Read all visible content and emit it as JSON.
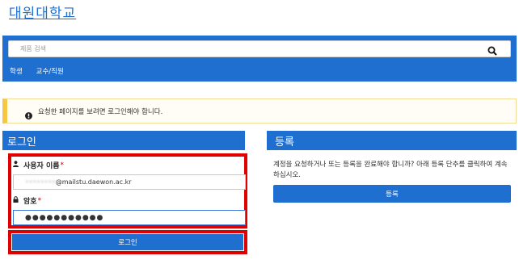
{
  "header": {
    "site_title": "대원대학교"
  },
  "search": {
    "placeholder": "제품 검색",
    "icon": "search-icon"
  },
  "nav": {
    "items": [
      {
        "label": "학생"
      },
      {
        "label": "교수/직원"
      }
    ]
  },
  "alert": {
    "text": "요청한 페이지를 보려면 로그인해야 합니다.",
    "icon": "exclamation-circle-icon",
    "accent_color": "#f6c744"
  },
  "login": {
    "title": "로그인",
    "username_label": "사용자 이름",
    "required_mark": "*",
    "username_prefix": "••••••••",
    "username_value": "@mailstu.daewon.ac.kr",
    "password_label": "암호",
    "password_value": "●●●●●●●●●●●",
    "submit_label": "로그인",
    "highlight_color": "#e00000"
  },
  "register": {
    "title": "등록",
    "description": "계정을 요청하거나 또는 등록을 완료해야 합니까? 아래 등록 단추를 클릭하여 계속하십시오.",
    "button_label": "등록"
  },
  "colors": {
    "brand_blue": "#1f6fd0"
  }
}
